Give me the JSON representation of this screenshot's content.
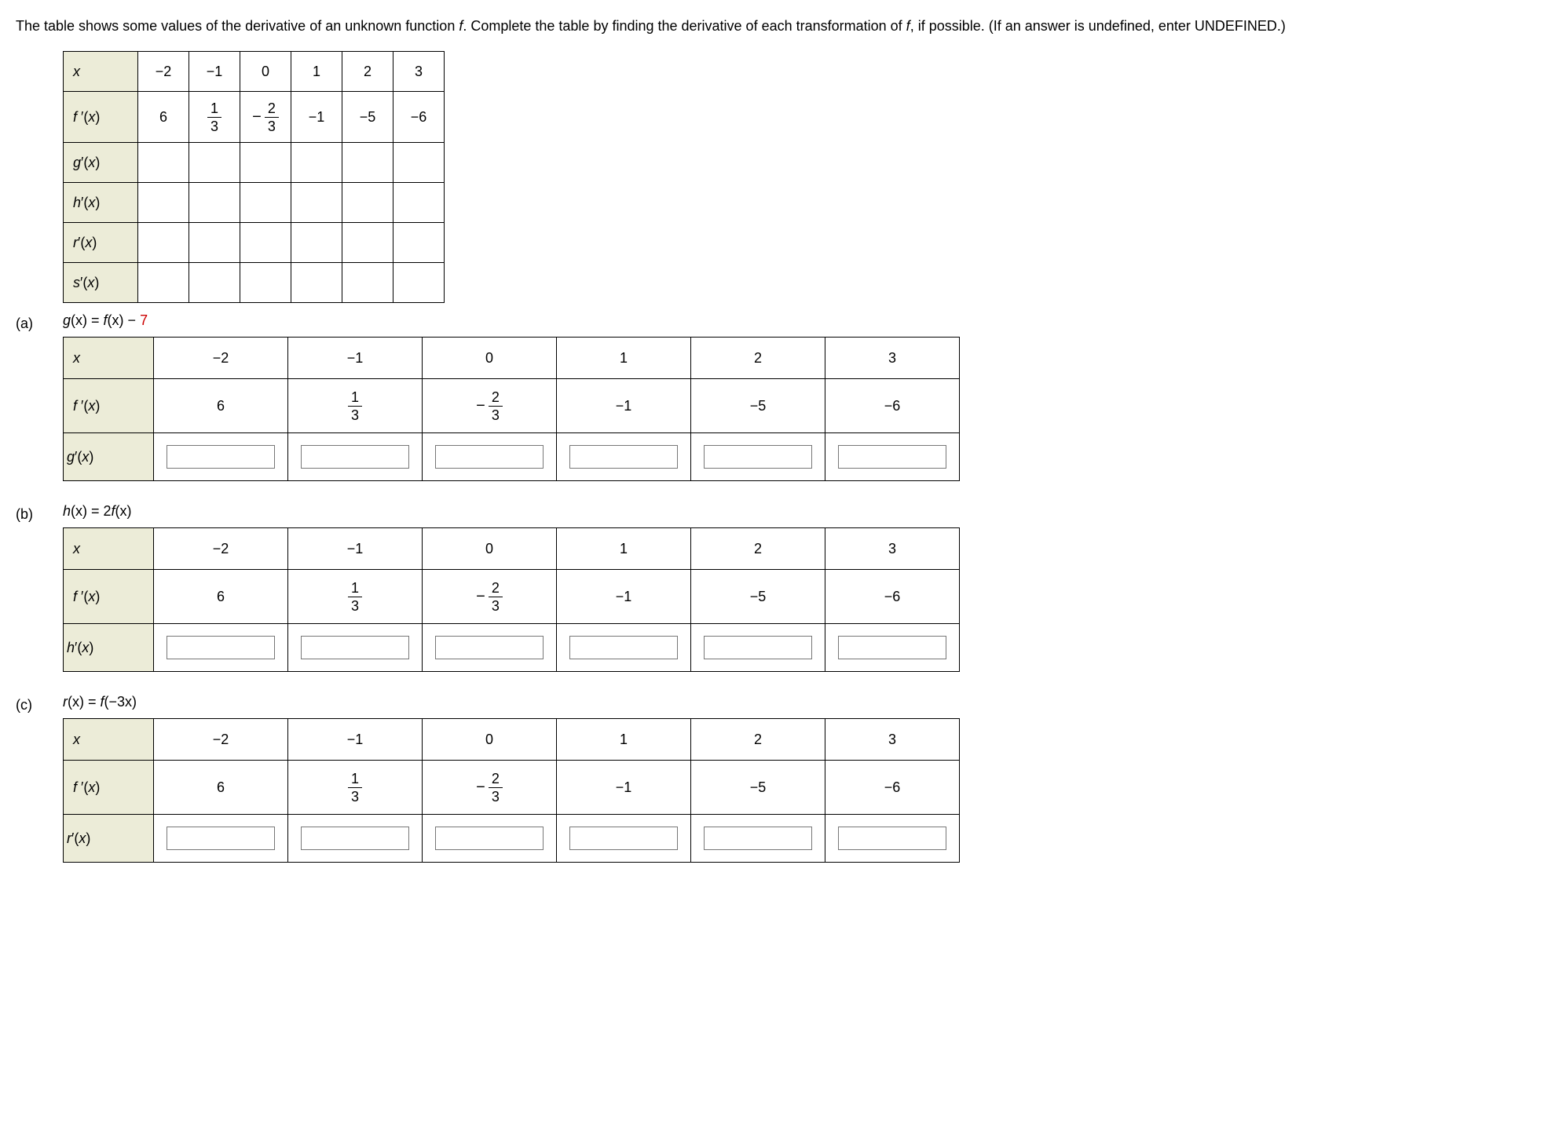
{
  "instructions_a": "The table shows some values of the derivative of an unknown function ",
  "instructions_b": ". Complete the table by finding the derivative of each transformation of ",
  "instructions_c": ", if possible. (If an answer is undefined, enter UNDEFINED.)",
  "f_letter": "f",
  "labels": {
    "x": "x",
    "fprime": "f ′(x)",
    "gprime": "g′(x)",
    "hprime": "h′(x)",
    "rprime": "r′(x)",
    "sprime": "s′(x)"
  },
  "xvals": [
    "−2",
    "−1",
    "0",
    "1",
    "2",
    "3"
  ],
  "fprime_vals": {
    "c0": "6",
    "c1": {
      "num": "1",
      "den": "3"
    },
    "c2": {
      "neg": true,
      "num": "2",
      "den": "3"
    },
    "c3": "−1",
    "c4": "−5",
    "c5": "−6"
  },
  "parts": {
    "a": {
      "label": "(a)",
      "formula_lhs": "g",
      "formula_rhs_a": "(x) = ",
      "formula_rhs_b": "f",
      "formula_rhs_c": "(x) − ",
      "constant": "7",
      "deriv_row": "gprime"
    },
    "b": {
      "label": "(b)",
      "formula_lhs": "h",
      "formula_rhs_a": "(x) = 2",
      "formula_rhs_b": "f",
      "formula_rhs_c": "(x)",
      "deriv_row": "hprime"
    },
    "c": {
      "label": "(c)",
      "formula_lhs": "r",
      "formula_rhs_a": "(x) = ",
      "formula_rhs_b": "f",
      "formula_rhs_c": "(−3x)",
      "deriv_row": "rprime"
    }
  }
}
